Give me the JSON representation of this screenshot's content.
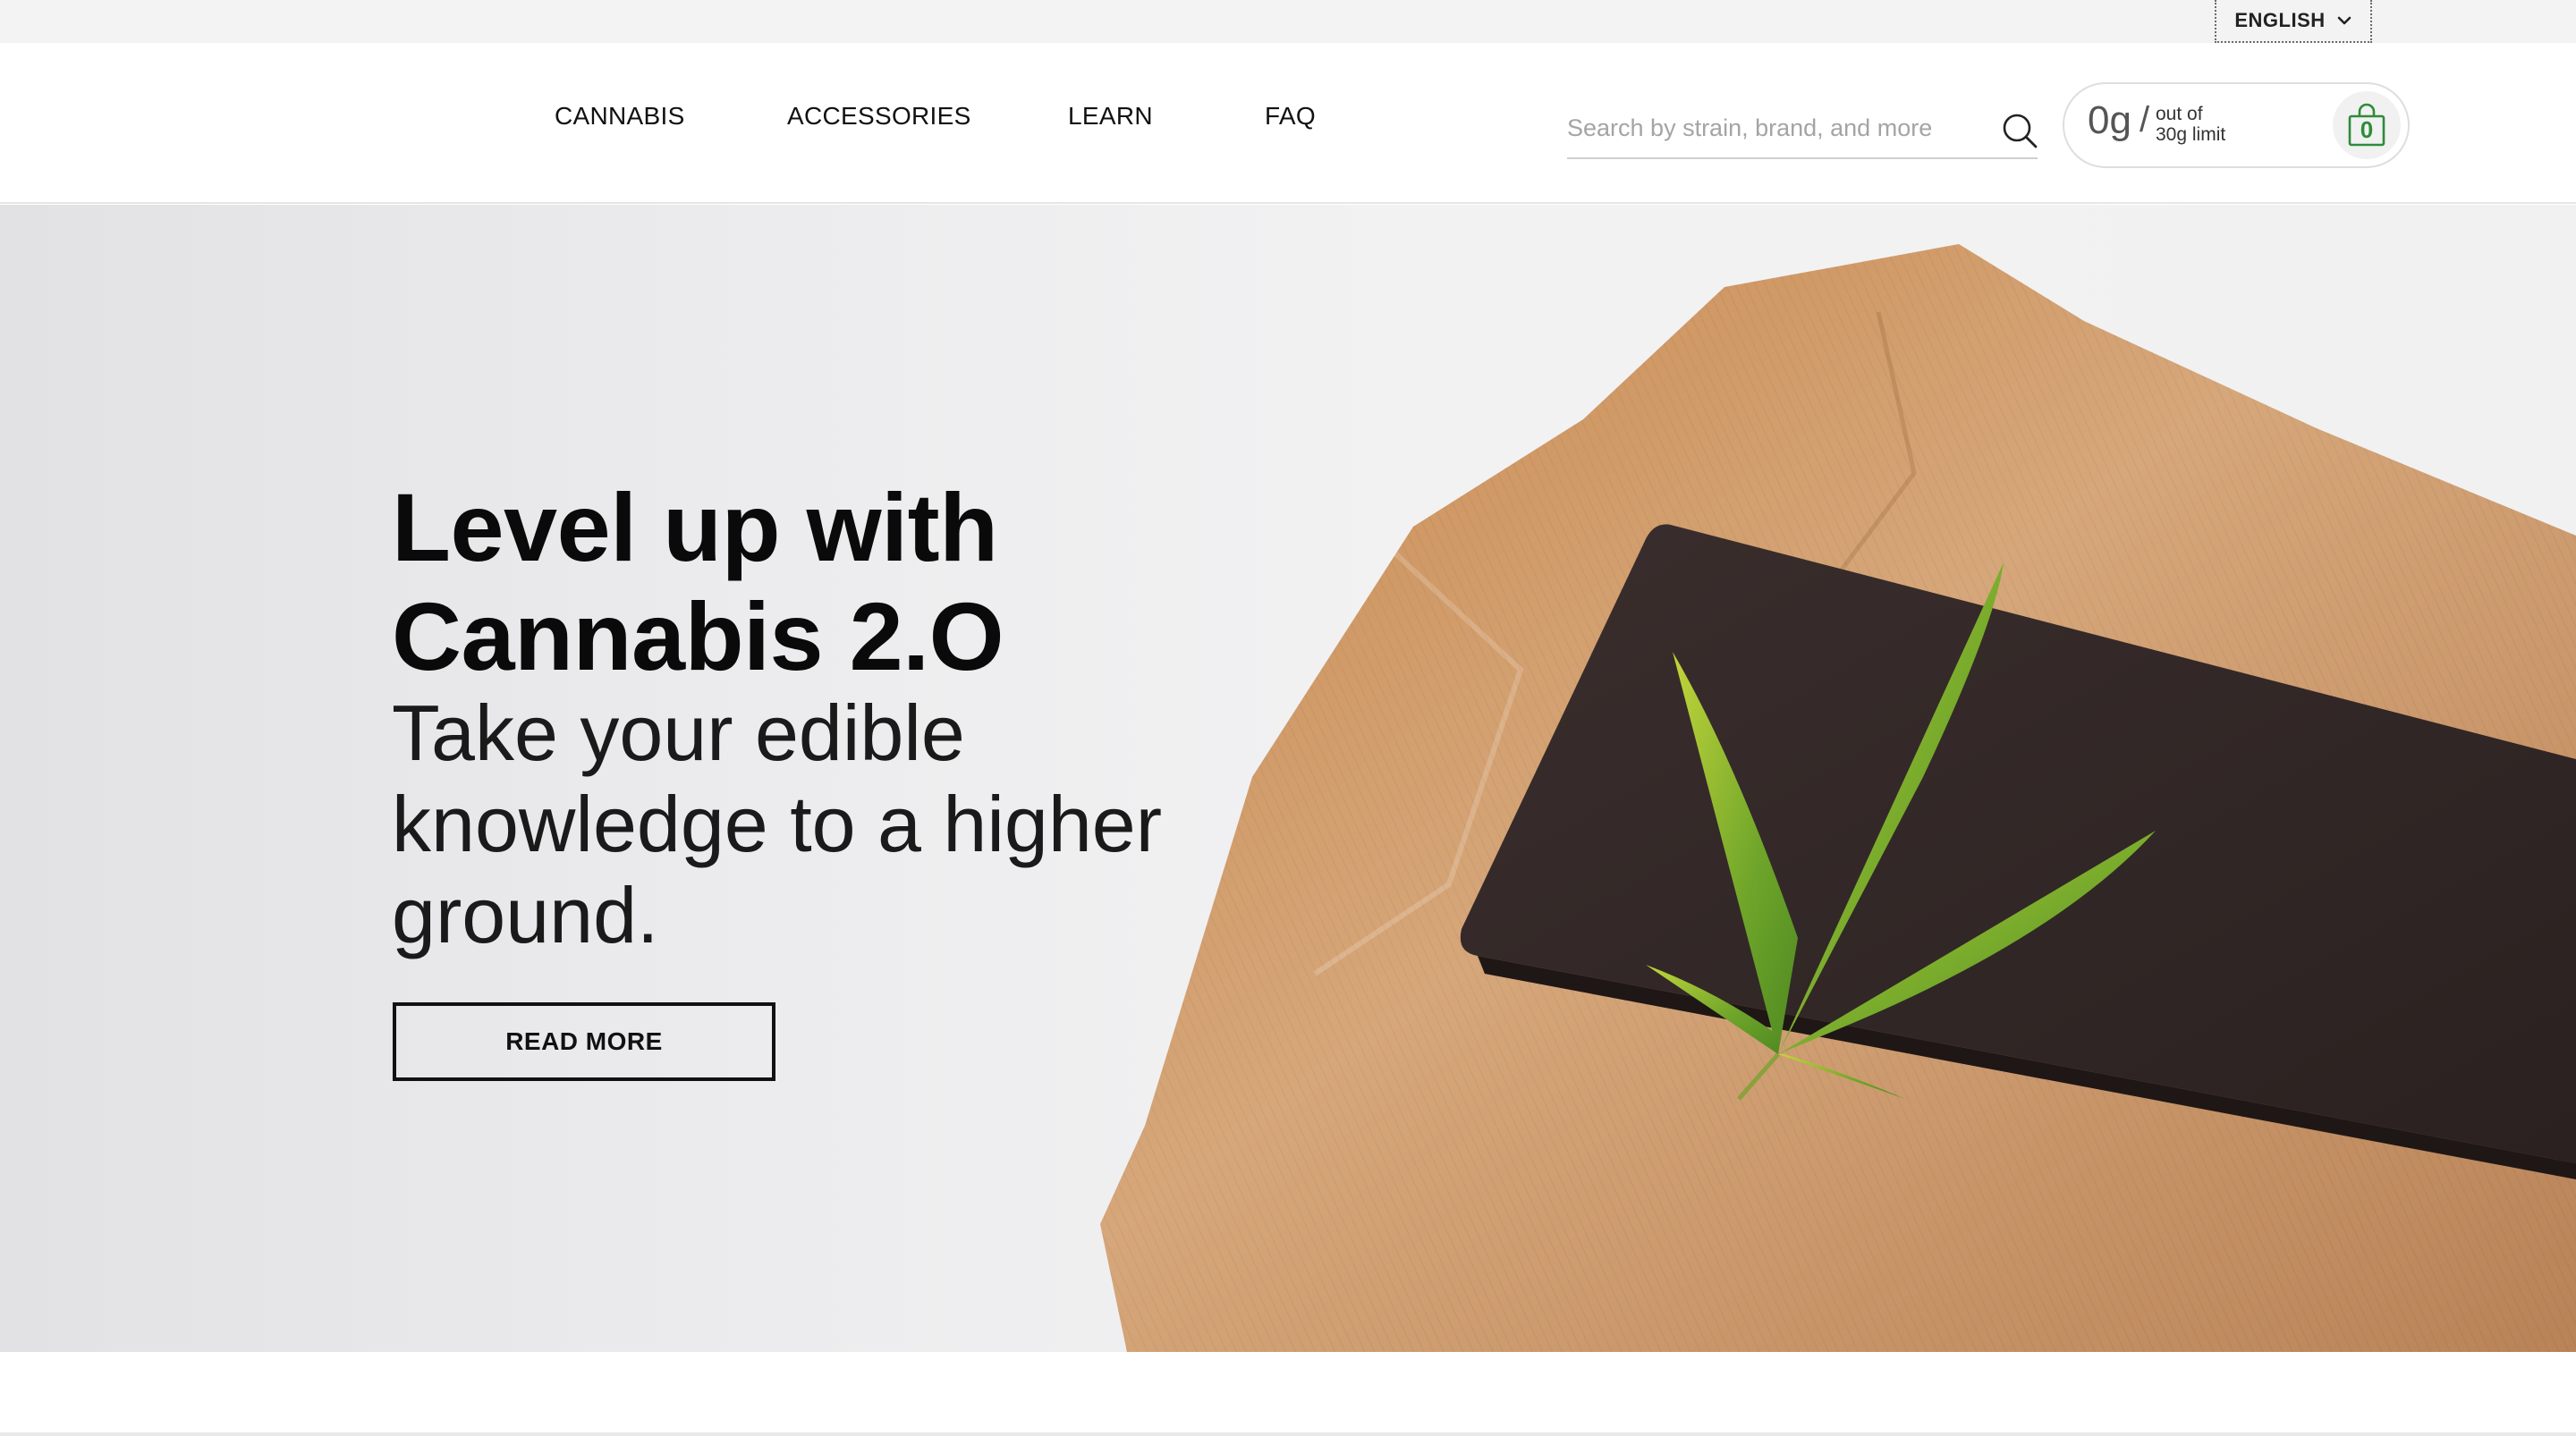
{
  "language": {
    "selected": "ENGLISH",
    "icon": "chevron-down-icon"
  },
  "nav": {
    "items": [
      {
        "label": "CANNABIS"
      },
      {
        "label": "ACCESSORIES"
      },
      {
        "label": "LEARN"
      },
      {
        "label": "FAQ"
      }
    ]
  },
  "search": {
    "placeholder": "Search by strain, brand, and more",
    "value": "",
    "icon": "search-icon"
  },
  "cart": {
    "amount": "0g",
    "separator": "/",
    "limit_line1": "out of",
    "limit_line2": "30g limit",
    "count": "0",
    "icon": "shopping-bag-icon",
    "accent_color": "#2e8b3a"
  },
  "hero": {
    "headline_line1": "Level up with",
    "headline_line2": "Cannabis 2.O",
    "subline_line1": "Take your edible",
    "subline_line2": "knowledge to a higher",
    "subline_line3": "ground.",
    "cta_label": "READ MORE"
  }
}
